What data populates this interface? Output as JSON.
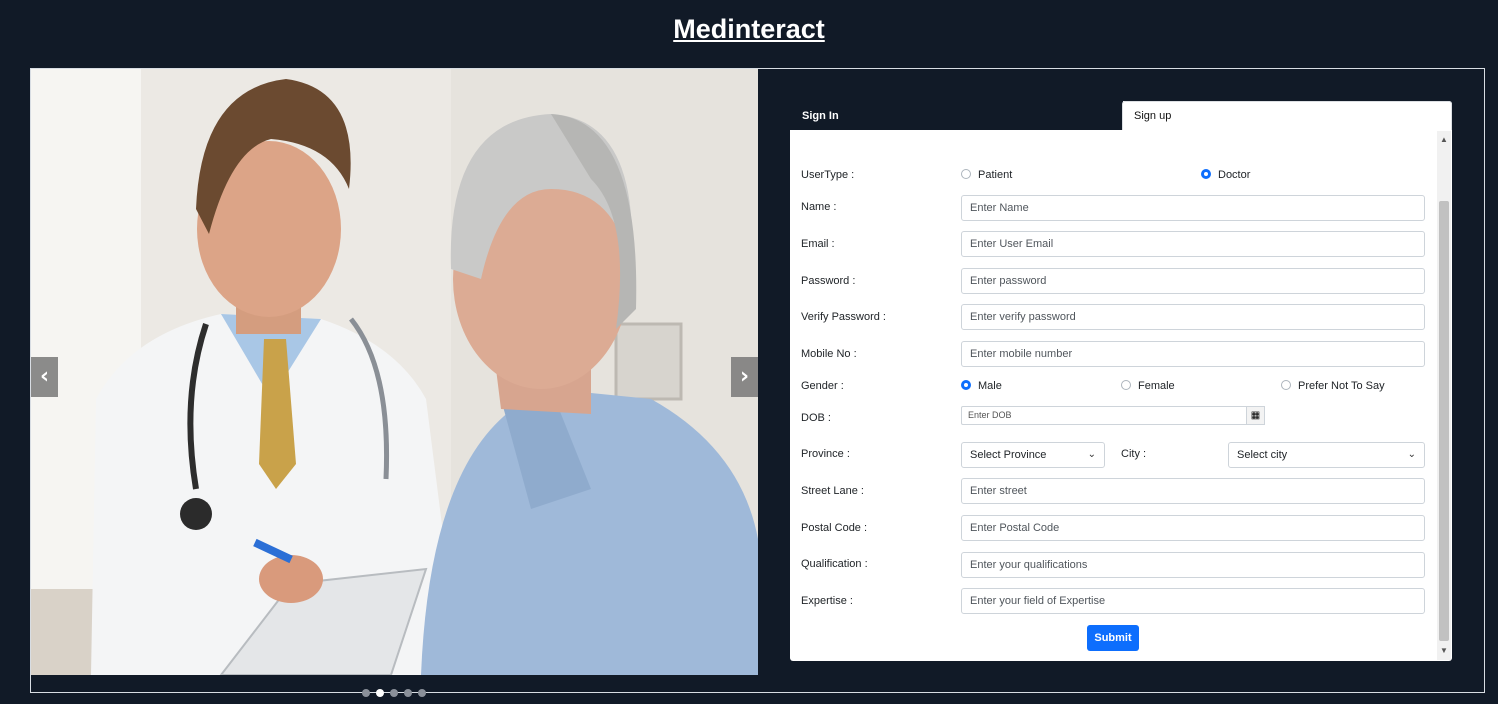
{
  "app": {
    "title": "Medinteract"
  },
  "carousel": {
    "prev_label": "‹",
    "next_label": "›",
    "slide_count": 5,
    "active_slide": 2
  },
  "tabs": {
    "signin": "Sign In",
    "signup": "Sign up"
  },
  "form": {
    "usertype": {
      "label": "UserType :",
      "options": [
        "Patient",
        "Doctor"
      ],
      "selected": "Doctor"
    },
    "name": {
      "label": "Name :",
      "placeholder": "Enter Name"
    },
    "email": {
      "label": "Email :",
      "placeholder": "Enter User Email"
    },
    "password": {
      "label": "Password :",
      "placeholder": "Enter password"
    },
    "verify_password": {
      "label": "Verify Password :",
      "placeholder": "Enter verify password"
    },
    "mobile": {
      "label": "Mobile No :",
      "placeholder": "Enter mobile number"
    },
    "gender": {
      "label": "Gender :",
      "options": [
        "Male",
        "Female",
        "Prefer Not To Say"
      ],
      "selected": "Male"
    },
    "dob": {
      "label": "DOB :",
      "placeholder": "Enter DOB"
    },
    "province": {
      "label": "Province :",
      "value": "Select Province"
    },
    "city": {
      "label": "City :",
      "value": "Select city"
    },
    "street": {
      "label": "Street Lane :",
      "placeholder": "Enter street"
    },
    "postal": {
      "label": "Postal Code :",
      "placeholder": "Enter Postal Code"
    },
    "qualification": {
      "label": "Qualification :",
      "placeholder": "Enter your qualifications"
    },
    "expertise": {
      "label": "Expertise :",
      "placeholder": "Enter your field of Expertise"
    },
    "submit_label": "Submit"
  },
  "colors": {
    "background": "#111a27",
    "primary": "#0d6efd"
  },
  "icons": {
    "calendar": "calendar-icon",
    "chevron": "chevron-down-icon"
  }
}
